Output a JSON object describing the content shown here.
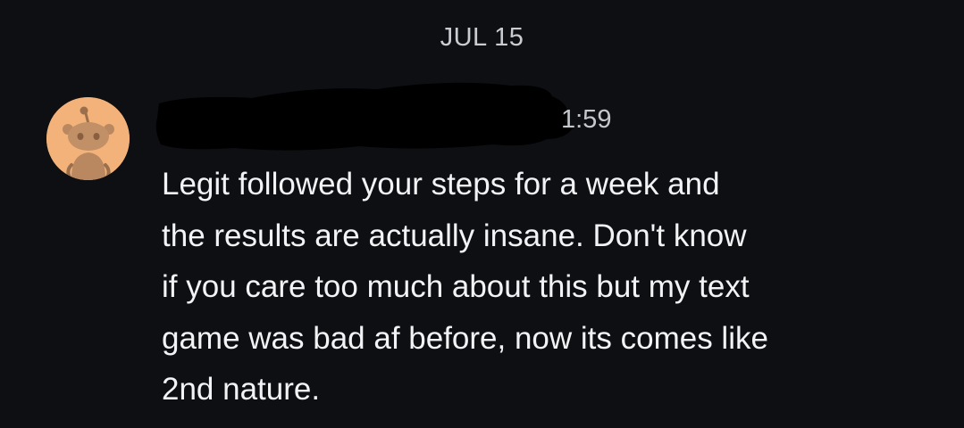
{
  "conversation": {
    "date_label": "JUL 15"
  },
  "message": {
    "avatar_icon": "reddit-snoo-avatar-icon",
    "avatar_color": "#f3b27a",
    "sender_redacted": true,
    "timestamp": "1:59",
    "lines": [
      "Legit followed your steps for a week and",
      "the results are actually insane. Don't know",
      "if you care too much about this but my text",
      "game was bad af before, now its comes like",
      "2nd nature."
    ]
  }
}
